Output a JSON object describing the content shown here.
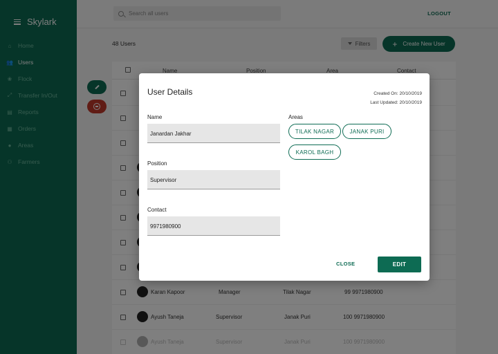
{
  "app": {
    "title": "Skylark",
    "menu_icon": "menu-icon"
  },
  "sidebar": {
    "items": [
      {
        "label": "Home",
        "icon": "home-icon",
        "active": false
      },
      {
        "label": "Users",
        "icon": "users-icon",
        "active": true
      },
      {
        "label": "Flock",
        "icon": "flock-icon",
        "active": false
      },
      {
        "label": "Transfer In/Out",
        "icon": "transfer-icon",
        "active": false
      },
      {
        "label": "Reports",
        "icon": "reports-icon",
        "active": false
      },
      {
        "label": "Orders",
        "icon": "orders-icon",
        "active": false
      },
      {
        "label": "Areas",
        "icon": "location-icon",
        "active": false
      },
      {
        "label": "Farmers",
        "icon": "farmers-icon",
        "active": false
      }
    ]
  },
  "topbar": {
    "search_placeholder": "Search all users",
    "logout_label": "LOGOUT"
  },
  "toolbar": {
    "user_count": "48 Users",
    "filters_label": "Filters",
    "create_label": "Create New User"
  },
  "table": {
    "headers": {
      "name": "Name",
      "position": "Position",
      "area": "Area",
      "contact": "Contact"
    },
    "rows": [
      {
        "name": "Karan Kapoor",
        "position": "Manager",
        "area": "Tilak Nagar",
        "contact": "99 9971980900"
      },
      {
        "name": "Ayush Taneja",
        "position": "Supervisor",
        "area": "Janak Puri",
        "contact": "100 9971980900"
      },
      {
        "name": "Ayush Taneja",
        "position": "Supervisor",
        "area": "Janak Puri",
        "contact": "100 9971980900"
      }
    ]
  },
  "modal": {
    "title": "User Details",
    "created_on": "Created On: 20/10/2019",
    "last_updated": "Last Updated: 20/10/2019",
    "name_label": "Name",
    "name_value": "Janardan Jakhar",
    "position_label": "Position",
    "position_value": "Supervisor",
    "contact_label": "Contact",
    "contact_value": "9971980900",
    "areas_label": "Areas",
    "areas": [
      "TILAK NAGAR",
      "JANAK PURI",
      "KAROL BAGH"
    ],
    "close_label": "CLOSE",
    "edit_label": "EDIT"
  },
  "colors": {
    "primary": "#0d6b53",
    "danger": "#c0392b"
  }
}
